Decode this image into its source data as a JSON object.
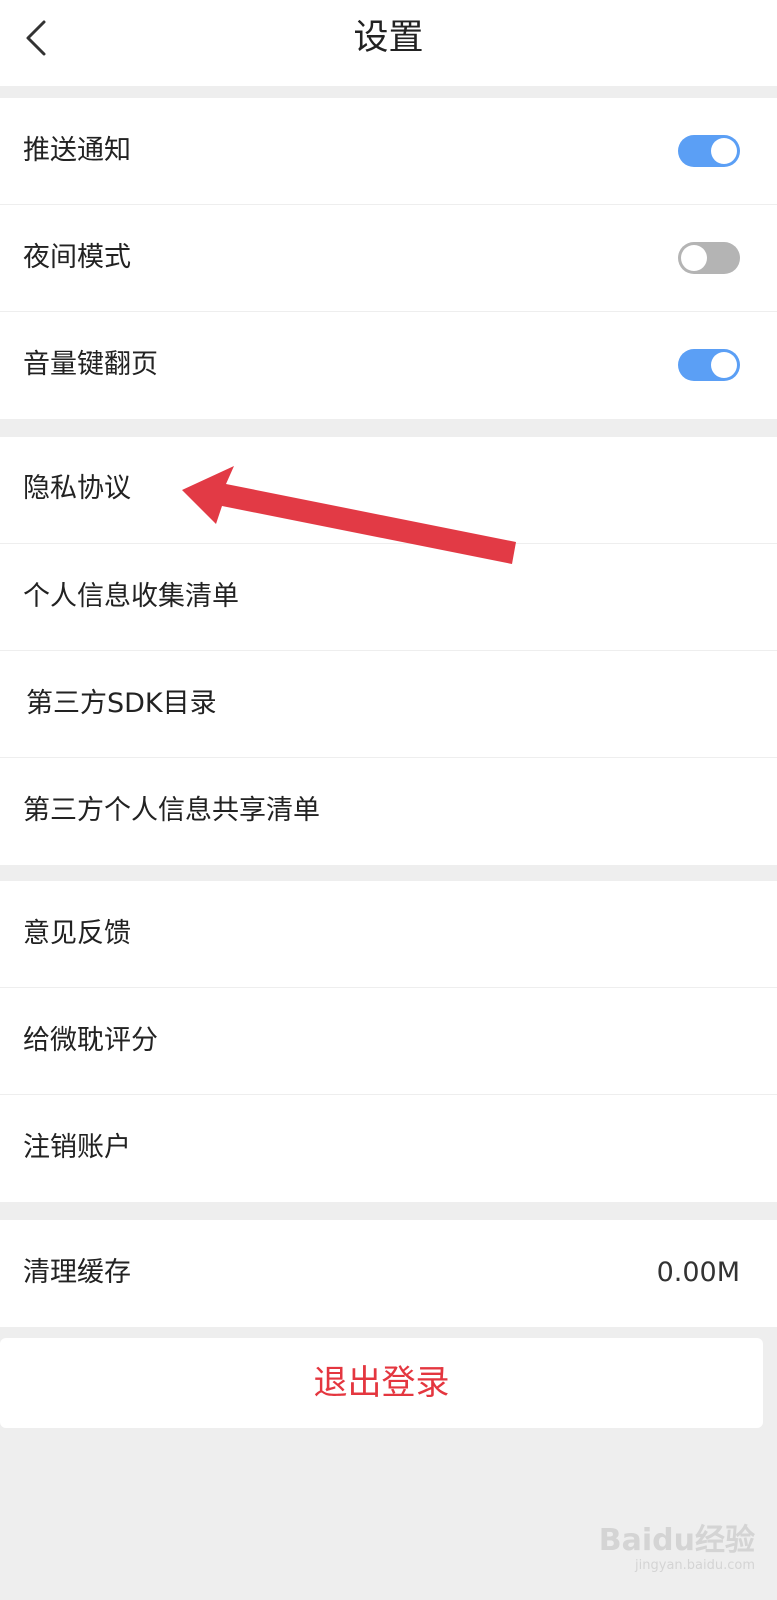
{
  "header": {
    "title": "设置",
    "back_icon": "chevron-left-icon"
  },
  "groups": [
    {
      "items": [
        {
          "label": "推送通知",
          "toggle": true
        },
        {
          "label": "夜间模式",
          "toggle": false
        },
        {
          "label": "音量键翻页",
          "toggle": true
        }
      ]
    },
    {
      "items": [
        {
          "label": "隐私协议"
        },
        {
          "label": "个人信息收集清单"
        },
        {
          "label": "第三方SDK目录"
        },
        {
          "label": "第三方个人信息共享清单"
        }
      ]
    },
    {
      "items": [
        {
          "label": "意见反馈"
        },
        {
          "label": "给微耽评分"
        },
        {
          "label": "注销账户"
        }
      ]
    },
    {
      "items": [
        {
          "label": "清理缓存",
          "value": "0.00M"
        }
      ]
    }
  ],
  "logout_label": "退出登录",
  "watermark": {
    "main": "Baidu经验",
    "sub": "jingyan.baidu.com"
  },
  "colors": {
    "toggle_on": "#5b9ff5",
    "toggle_off": "#b4b4b4",
    "logout_text": "#e4363f",
    "annotation_arrow": "#e23a45"
  }
}
